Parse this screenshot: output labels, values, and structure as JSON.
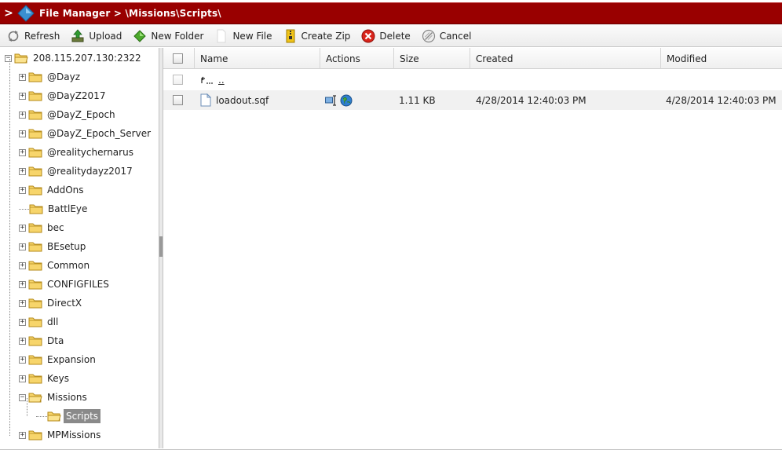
{
  "titlebar": {
    "title": "File Manager > \\Missions\\Scripts\\",
    "chevron": ">"
  },
  "toolbar": {
    "refresh_label": "Refresh",
    "upload_label": "Upload",
    "new_folder_label": "New Folder",
    "new_file_label": "New File",
    "create_zip_label": "Create Zip",
    "delete_label": "Delete",
    "cancel_label": "Cancel"
  },
  "tree": {
    "root": {
      "label": "208.115.207.130:2322",
      "expander": "−"
    },
    "items": [
      {
        "label": "@Dayz",
        "expander": "+"
      },
      {
        "label": "@DayZ2017",
        "expander": "+"
      },
      {
        "label": "@DayZ_Epoch",
        "expander": "+"
      },
      {
        "label": "@DayZ_Epoch_Server",
        "expander": "+"
      },
      {
        "label": "@realitychernarus",
        "expander": "+"
      },
      {
        "label": "@realitydayz2017",
        "expander": "+"
      },
      {
        "label": "AddOns",
        "expander": "+"
      },
      {
        "label": "BattlEye",
        "expander": ""
      },
      {
        "label": "bec",
        "expander": "+"
      },
      {
        "label": "BEsetup",
        "expander": "+"
      },
      {
        "label": "Common",
        "expander": "+"
      },
      {
        "label": "CONFIGFILES",
        "expander": "+"
      },
      {
        "label": "DirectX",
        "expander": "+"
      },
      {
        "label": "dll",
        "expander": "+"
      },
      {
        "label": "Dta",
        "expander": "+"
      },
      {
        "label": "Expansion",
        "expander": "+"
      },
      {
        "label": "Keys",
        "expander": "+"
      },
      {
        "label": "Missions",
        "expander": "−"
      },
      {
        "label": "Scripts",
        "expander": ""
      },
      {
        "label": "MPMissions",
        "expander": "+"
      }
    ]
  },
  "grid": {
    "columns": {
      "name": "Name",
      "actions": "Actions",
      "size": "Size",
      "created": "Created",
      "modified": "Modified"
    },
    "parent_row": {
      "name": ".."
    },
    "files": [
      {
        "name": "loadout.sqf",
        "size": "1.11 KB",
        "created": "4/28/2014 12:40:03 PM",
        "modified": "4/28/2014 12:40:03 PM"
      }
    ]
  },
  "colors": {
    "titlebar": "#990000",
    "selected_tree": "#8a8a8a",
    "folder": "#f2c94c",
    "delete": "#d9241b"
  }
}
